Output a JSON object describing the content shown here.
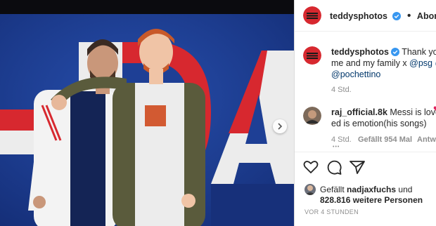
{
  "post": {
    "author": "teddysphotos",
    "follow_label": "Abonnieren",
    "separator": "•"
  },
  "caption": {
    "author": "teddysphotos",
    "line1_text": "Thank you",
    "line2_text": "me and my family x",
    "line2_link1": "@psg",
    "line2_link2": "@",
    "line3_link": "@pochettino",
    "time": "4 Std."
  },
  "comment": {
    "author": "raj_official.8k",
    "line1_text": "Messi is love",
    "line2_text": "ed is emotion(his songs)",
    "time": "4 Std.",
    "likes": "Gefällt 954 Mal",
    "reply": "Antwo",
    "more": "•••"
  },
  "likes": {
    "prefix": "Gefällt",
    "user": "nadjaxfuchs",
    "middle": "und",
    "count": "828.816 weitere Personen"
  },
  "posted_ago": "VOR 4 STUNDEN",
  "icons": {
    "verified": "verified-badge-icon",
    "like": "heart-icon",
    "comment": "comment-bubble-icon",
    "share": "paper-plane-icon",
    "next": "chevron-right-icon",
    "comment_like": "small-heart-icon"
  },
  "colors": {
    "psg_blue": "#1e3f95",
    "psg_red": "#d7282f",
    "verified_blue": "#3897f0",
    "link_blue": "#00376b",
    "meta_gray": "#8e8e8e"
  }
}
